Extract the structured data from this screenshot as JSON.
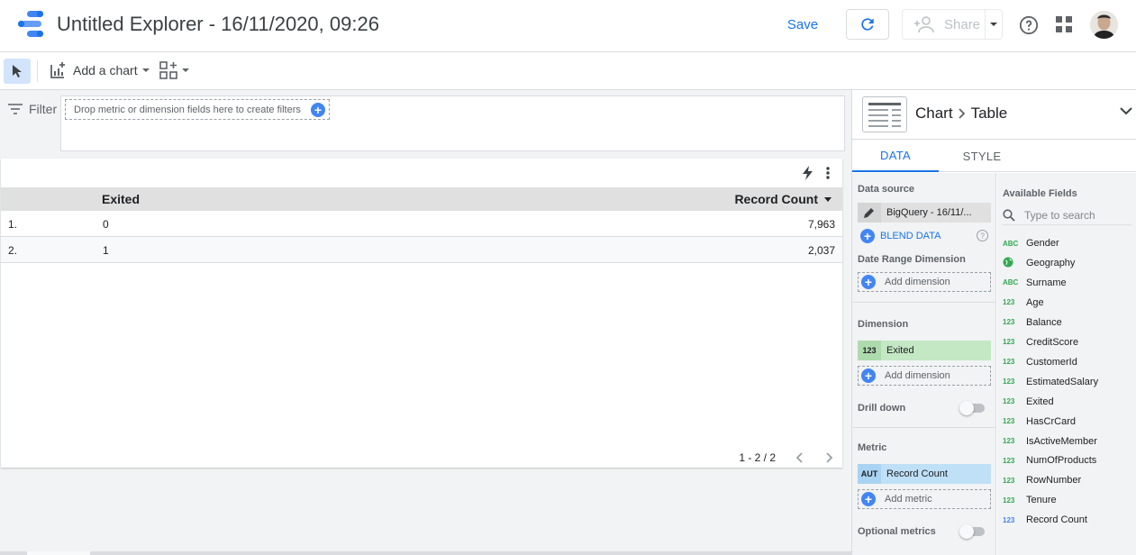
{
  "header": {
    "title": "Untitled Explorer - 16/11/2020, 09:26",
    "save_label": "Save",
    "share_label": "Share"
  },
  "toolbar": {
    "add_chart_label": "Add a chart"
  },
  "filter": {
    "label": "Filter",
    "hint": "Drop metric or dimension fields here to create filters"
  },
  "table": {
    "columns": [
      "Exited",
      "Record Count"
    ],
    "rows": [
      {
        "index": "1.",
        "exited": "0",
        "count": "7,963"
      },
      {
        "index": "2.",
        "exited": "1",
        "count": "2,037"
      }
    ],
    "pagination": "1 - 2 / 2"
  },
  "panel": {
    "crumb_root": "Chart",
    "crumb_leaf": "Table",
    "tabs": [
      "DATA",
      "STYLE"
    ],
    "data_source_title": "Data source",
    "data_source_name": "BigQuery - 16/11/...",
    "blend_label": "BLEND DATA",
    "date_range_title": "Date Range Dimension",
    "add_dimension_label": "Add dimension",
    "dimension_title": "Dimension",
    "dimension_tag": "123",
    "dimension_value": "Exited",
    "drill_down_label": "Drill down",
    "metric_title": "Metric",
    "metric_tag": "AUT",
    "metric_value": "Record Count",
    "add_metric_label": "Add metric",
    "optional_metrics_label": "Optional metrics"
  },
  "fields": {
    "title": "Available Fields",
    "search_placeholder": "Type to search",
    "items": [
      {
        "type": "ABC",
        "name": "Gender",
        "color": "#34a853"
      },
      {
        "type": "geo",
        "name": "Geography",
        "color": "#34a853"
      },
      {
        "type": "ABC",
        "name": "Surname",
        "color": "#34a853"
      },
      {
        "type": "123",
        "name": "Age",
        "color": "#34a853"
      },
      {
        "type": "123",
        "name": "Balance",
        "color": "#34a853"
      },
      {
        "type": "123",
        "name": "CreditScore",
        "color": "#34a853"
      },
      {
        "type": "123",
        "name": "CustomerId",
        "color": "#34a853"
      },
      {
        "type": "123",
        "name": "EstimatedSalary",
        "color": "#34a853"
      },
      {
        "type": "123",
        "name": "Exited",
        "color": "#34a853"
      },
      {
        "type": "123",
        "name": "HasCrCard",
        "color": "#34a853"
      },
      {
        "type": "123",
        "name": "IsActiveMember",
        "color": "#34a853"
      },
      {
        "type": "123",
        "name": "NumOfProducts",
        "color": "#34a853"
      },
      {
        "type": "123",
        "name": "RowNumber",
        "color": "#34a853"
      },
      {
        "type": "123",
        "name": "Tenure",
        "color": "#34a853"
      },
      {
        "type": "123",
        "name": "Record Count",
        "color": "#4285f4"
      }
    ]
  },
  "colors": {
    "accent": "#1a73e8",
    "dimension": "#c4e7c4",
    "metric": "#bfe0f7"
  }
}
